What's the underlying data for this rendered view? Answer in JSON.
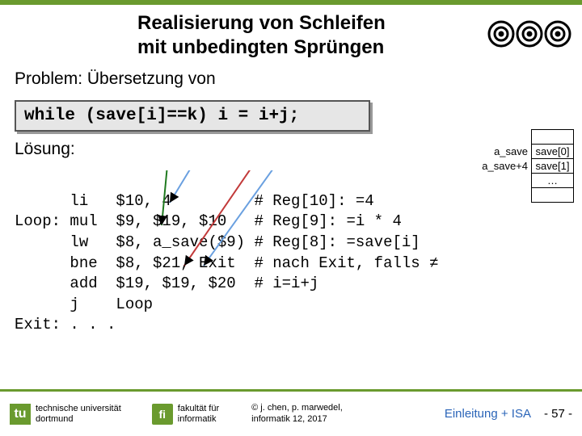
{
  "header": {
    "title_line1": "Realisierung von Schleifen",
    "title_line2": "mit unbedingten Sprüngen"
  },
  "problem_label": "Problem: Übersetzung von",
  "code": "while (save[i]==k) i = i+j;",
  "mem": {
    "rows": [
      {
        "addr": "a_save",
        "cell": "save[0]"
      },
      {
        "addr": "a_save+4",
        "cell": "save[1]"
      },
      {
        "addr": "",
        "cell": "…"
      }
    ]
  },
  "loesung_label": "Lösung:",
  "asm_lines": [
    "      li   $10, 4         # Reg[10]: =4",
    "Loop: mul  $9, $19, $10   # Reg[9]: =i * 4",
    "      lw   $8, a_save($9) # Reg[8]: =save[i]",
    "      bne  $8, $21, Exit  # nach Exit, falls ≠",
    "      add  $19, $19, $20  # i=i+j",
    "      j    Loop",
    "Exit: . . ."
  ],
  "footer": {
    "uni1": "technische universität",
    "uni2": "dortmund",
    "fac1": "fakultät für",
    "fac2": "informatik",
    "copy1": "© j. chen, p. marwedel,",
    "copy2": "informatik 12, 2017",
    "crumb": "Einleitung + ISA",
    "page": "- 57 -",
    "tu": "tu",
    "fi": "fi"
  }
}
